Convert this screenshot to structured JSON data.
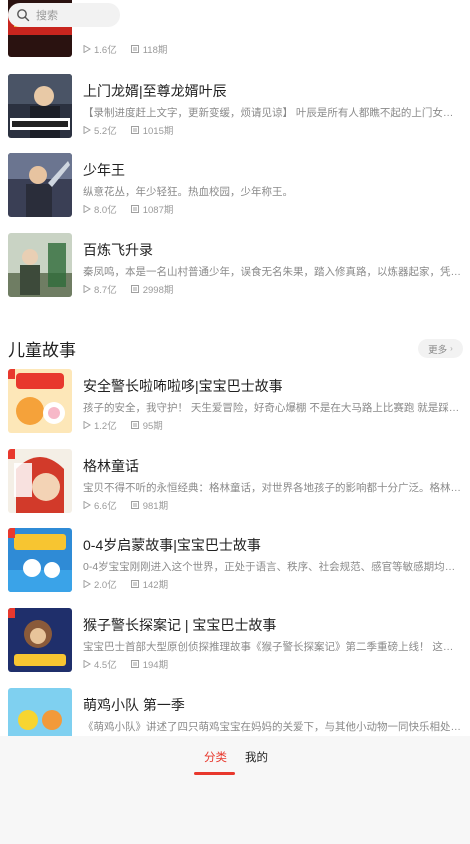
{
  "search": {
    "placeholder": "搜索"
  },
  "top_items": [
    {
      "title": "",
      "desc": "",
      "plays": "1.6亿",
      "episodes": "118期"
    },
    {
      "title": "上门龙婿|至尊龙婿叶辰",
      "desc": "【录制进度赶上文字，更新变缓，烦请见谅】 叶辰是所有人都瞧不起的上门女婿…",
      "plays": "5.2亿",
      "episodes": "1015期"
    },
    {
      "title": "少年王",
      "desc": "纵意花丛，年少轻狂。热血校园，少年称王。",
      "plays": "8.0亿",
      "episodes": "1087期"
    },
    {
      "title": "百炼飞升录",
      "desc": "秦凤鸣，本是一名山村普通少年，误食无名朱果，踏入修真路，以炼器起家，凭…",
      "plays": "8.7亿",
      "episodes": "2998期"
    }
  ],
  "section": {
    "title": "儿童故事",
    "more": "更多"
  },
  "kid_items": [
    {
      "title": "安全警长啦咘啦哆|宝宝巴士故事",
      "desc": "孩子的安全，我守护！ 天生爱冒险，好奇心爆棚 不是在大马路上比赛跑 就是踩着…",
      "plays": "1.2亿",
      "episodes": "95期"
    },
    {
      "title": "格林童话",
      "desc": "宝贝不得不听的永恒经典：格林童话，对世界各地孩子的影响都十分广泛。格林…",
      "plays": "6.6亿",
      "episodes": "981期"
    },
    {
      "title": "0-4岁启蒙故事|宝宝巴士故事",
      "desc": "0-4岁宝宝刚刚进入这个世界，正处于语言、秩序、社会规范、感官等敏感期均高…",
      "plays": "2.0亿",
      "episodes": "142期"
    },
    {
      "title": "猴子警长探案记 | 宝宝巴士故事",
      "desc": "宝宝巴士首部大型原创侦探推理故事《猴子警长探案记》第二季重磅上线！ 这次…",
      "plays": "4.5亿",
      "episodes": "194期"
    },
    {
      "title": "萌鸡小队 第一季",
      "desc": "《萌鸡小队》讲述了四只萌鸡宝宝在妈妈的关爱下，与其他小动物一同快乐相处…",
      "plays": "",
      "episodes": ""
    }
  ],
  "tabbar": {
    "category": "分类",
    "mine": "我的"
  },
  "colors": {
    "accent": "#e8382d",
    "muted": "#9a9a9a"
  }
}
